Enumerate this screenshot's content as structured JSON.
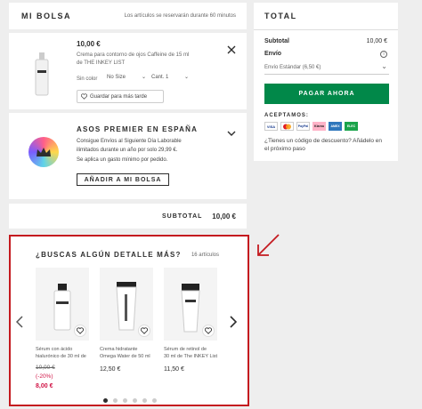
{
  "bag": {
    "title": "MI BOLSA",
    "reservation_note": "Los artículos se reservarán durante 60 minutos"
  },
  "item": {
    "price": "10,00 €",
    "description_line1": "Crema para contorno de ojos Caffeine de 15 ml",
    "description_line2": "de THE INKEY LIST",
    "color": "Sin color",
    "size": "No Size",
    "qty": "Cant. 1",
    "save_later": "Guardar para más tarde"
  },
  "premier": {
    "title": "ASOS PREMIER EN ESPAÑA",
    "line1": "Consigue Envíos al Siguiente Día Laborable",
    "line2": "ilimitados durante un año por solo 29,99 €.",
    "line3": "Se aplica un gasto mínimo por pedido.",
    "button": "AÑADIR A MI BOLSA"
  },
  "subtotal_bar": {
    "label": "SUBTOTAL",
    "value": "10,00 €"
  },
  "total": {
    "title": "TOTAL",
    "subtotal_label": "Subtotal",
    "subtotal_value": "10,00 €",
    "shipping_label": "Envío",
    "shipping_option": "Envío Estándar (6,50 €)",
    "pay_button": "PAGAR AHORA",
    "accepted_label": "ACEPTAMOS:",
    "cards": [
      "VISA",
      "MC",
      "PayPal",
      "Klarna",
      "AMEX",
      "ELEC"
    ],
    "discount_line1": "¿Tienes un código de descuento? Añádelo en",
    "discount_line2": "el próximo paso"
  },
  "recs": {
    "title": "¿BUSCAS ALGÚN DETALLE MÁS?",
    "count": "16 artículos",
    "products": [
      {
        "name1": "Sérum con ácido",
        "name2": "hialurónico de 30 ml de",
        "old_price": "10,00 €",
        "discount": "(-20%)",
        "price": "8,00 €"
      },
      {
        "name1": "Crema hidratante",
        "name2": "Omega Water de 50 ml",
        "price": "12,50 €"
      },
      {
        "name1": "Sérum de retinol de",
        "name2": "30 ml de The INKEY List",
        "price": "11,50 €"
      }
    ]
  },
  "colors": {
    "pay_green": "#018849",
    "highlight_red": "#c41a1f"
  }
}
